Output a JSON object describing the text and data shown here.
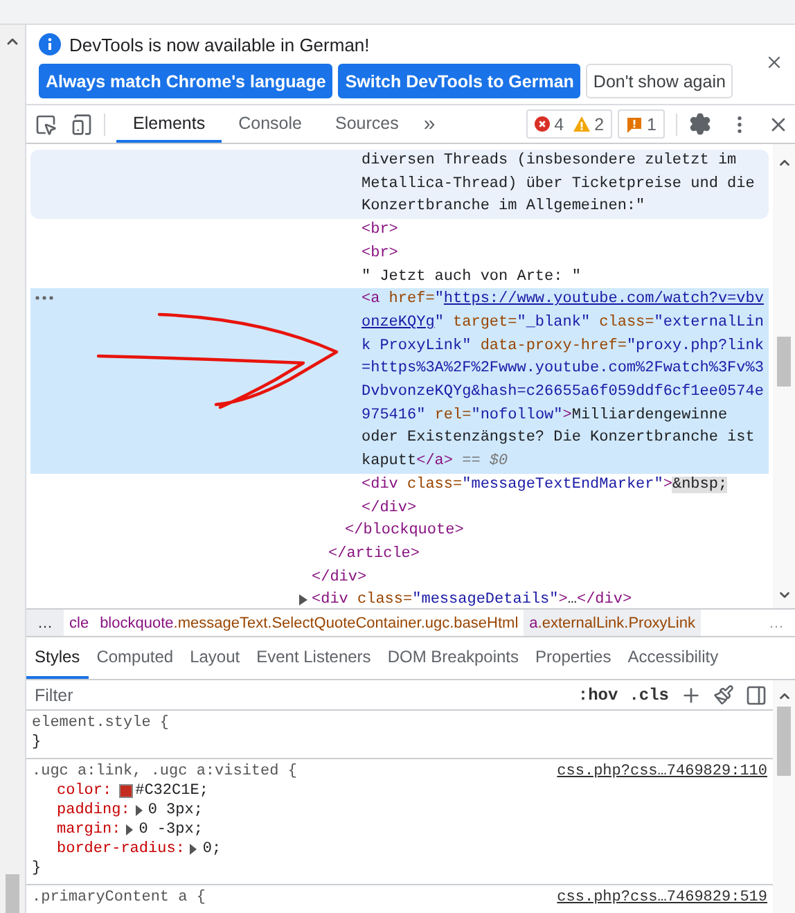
{
  "infobar": {
    "message": "DevTools is now available in German!",
    "buttons": [
      {
        "label": "Always match Chrome's language",
        "kind": "primary"
      },
      {
        "label": "Switch DevTools to German",
        "kind": "primary"
      },
      {
        "label": "Don't show again",
        "kind": "secondary"
      }
    ]
  },
  "toolbar": {
    "tabs": [
      {
        "label": "Elements",
        "selected": true
      },
      {
        "label": "Console",
        "selected": false
      },
      {
        "label": "Sources",
        "selected": false
      }
    ],
    "more": "»",
    "errors": "4",
    "warnings": "2",
    "issues": "1"
  },
  "dom_tree": [
    {
      "kind": "element",
      "close": [
        {
          "kind": "tag",
          "text": "</div>"
        }
      ],
      "children": [
        {
          "kind": "element",
          "close": [
            {
              "kind": "tag",
              "text": "</article>"
            }
          ],
          "children": [
            {
              "kind": "element",
              "close": [
                {
                  "kind": "tag",
                  "text": "</blockquote>"
                }
              ],
              "children": [
                {
                  "kind": "text",
                  "hovered": true,
                  "text": "diversen Threads (insbesondere zuletzt im Metallica-Thread) über Ticketpreise und die Konzertbranche im Allgemeinen:\""
                },
                {
                  "kind": "element",
                  "open": [
                    {
                      "kind": "tag",
                      "text": "<br>"
                    }
                  ]
                },
                {
                  "kind": "element",
                  "open": [
                    {
                      "kind": "tag",
                      "text": "<br>"
                    }
                  ]
                },
                {
                  "kind": "text",
                  "hovered": false,
                  "text": "\" Jetzt auch von Arte: \""
                },
                {
                  "kind": "element",
                  "selected": true,
                  "open": [
                    {
                      "kind": "tag",
                      "text": "<a"
                    },
                    {
                      "kind": "attr",
                      "text": " href="
                    },
                    {
                      "kind": "value",
                      "text": "\""
                    },
                    {
                      "kind": "link",
                      "text": "https://www.youtube.com/watch?v=vbvonzeKQYg"
                    },
                    {
                      "kind": "value",
                      "text": "\""
                    },
                    {
                      "kind": "attr",
                      "text": " target="
                    },
                    {
                      "kind": "value",
                      "text": "\"_blank\""
                    },
                    {
                      "kind": "attr",
                      "text": " class="
                    },
                    {
                      "kind": "value",
                      "text": "\"externalLink ProxyLink\""
                    },
                    {
                      "kind": "attr",
                      "text": " data-proxy-href="
                    },
                    {
                      "kind": "value",
                      "text": "\"proxy.php?link=https%3A%2F%2Fwww.youtube.com%2Fwatch%3Fv%3DvbvonzeKQYg&hash=c26655a6f059ddf6cf1ee0574e975416\""
                    },
                    {
                      "kind": "attr",
                      "text": " rel="
                    },
                    {
                      "kind": "value",
                      "text": "\"nofollow\""
                    },
                    {
                      "kind": "tag",
                      "text": ">"
                    },
                    {
                      "kind": "text",
                      "text": "Milliardengewinne oder Existenzängste? Die Konzertbranche ist kaputt"
                    },
                    {
                      "kind": "tag",
                      "text": "</a>"
                    },
                    {
                      "kind": "marker",
                      "text": " == $0"
                    }
                  ]
                },
                {
                  "kind": "element",
                  "open": [
                    {
                      "kind": "tag",
                      "text": "<div"
                    },
                    {
                      "kind": "attr",
                      "text": " class="
                    },
                    {
                      "kind": "value",
                      "text": "\"messageTextEndMarker\""
                    },
                    {
                      "kind": "tag",
                      "text": ">"
                    },
                    {
                      "kind": "entity",
                      "text": "&nbsp;"
                    }
                  ],
                  "close": [
                    {
                      "kind": "tag",
                      "text": "</div>"
                    }
                  ]
                }
              ]
            }
          ]
        }
      ]
    },
    {
      "kind": "element",
      "expanded": false,
      "open": [
        {
          "kind": "tag",
          "text": "<div"
        },
        {
          "kind": "attr",
          "text": " class="
        },
        {
          "kind": "value",
          "text": "\"messageDetails\""
        },
        {
          "kind": "tag",
          "text": ">"
        },
        {
          "kind": "text",
          "text": "…"
        },
        {
          "kind": "tag",
          "text": "</div>"
        }
      ]
    }
  ],
  "breadcrumbs": {
    "lead": "…",
    "items": [
      {
        "tag": "cle",
        "selected": false
      },
      {
        "tag": "blockquote",
        "classes": ".messageText.SelectQuoteContainer.ugc.baseHtml",
        "selected": false
      },
      {
        "tag": "a",
        "classes": ".externalLink.ProxyLink",
        "selected": true
      }
    ],
    "trail": "…"
  },
  "styles": {
    "tabs": [
      {
        "label": "Styles",
        "selected": true
      },
      {
        "label": "Computed",
        "selected": false
      },
      {
        "label": "Layout",
        "selected": false
      },
      {
        "label": "Event Listeners",
        "selected": false
      },
      {
        "label": "DOM Breakpoints",
        "selected": false
      },
      {
        "label": "Properties",
        "selected": false
      },
      {
        "label": "Accessibility",
        "selected": false
      }
    ],
    "filter": {
      "placeholder": "Filter"
    },
    "hov": ":hov",
    "cls": ".cls",
    "rules": [
      {
        "selector": "element.style {",
        "close": "}"
      },
      {
        "selector": ".ugc a:link, .ugc a:visited {",
        "source": "css.php?css…7469829:110",
        "close": "}",
        "declarations": [
          {
            "name": "color:",
            "value": "#C32C1E;",
            "color": "#c32c1e"
          },
          {
            "name": "padding:",
            "value": "0 3px;",
            "expandable": true
          },
          {
            "name": "margin:",
            "value": "0 -3px;",
            "expandable": true
          },
          {
            "name": "border-radius:",
            "value": "0;",
            "expandable": true
          }
        ]
      },
      {
        "selector": ".primaryContent a {",
        "source": "css.php?css…7469829:519"
      }
    ]
  }
}
